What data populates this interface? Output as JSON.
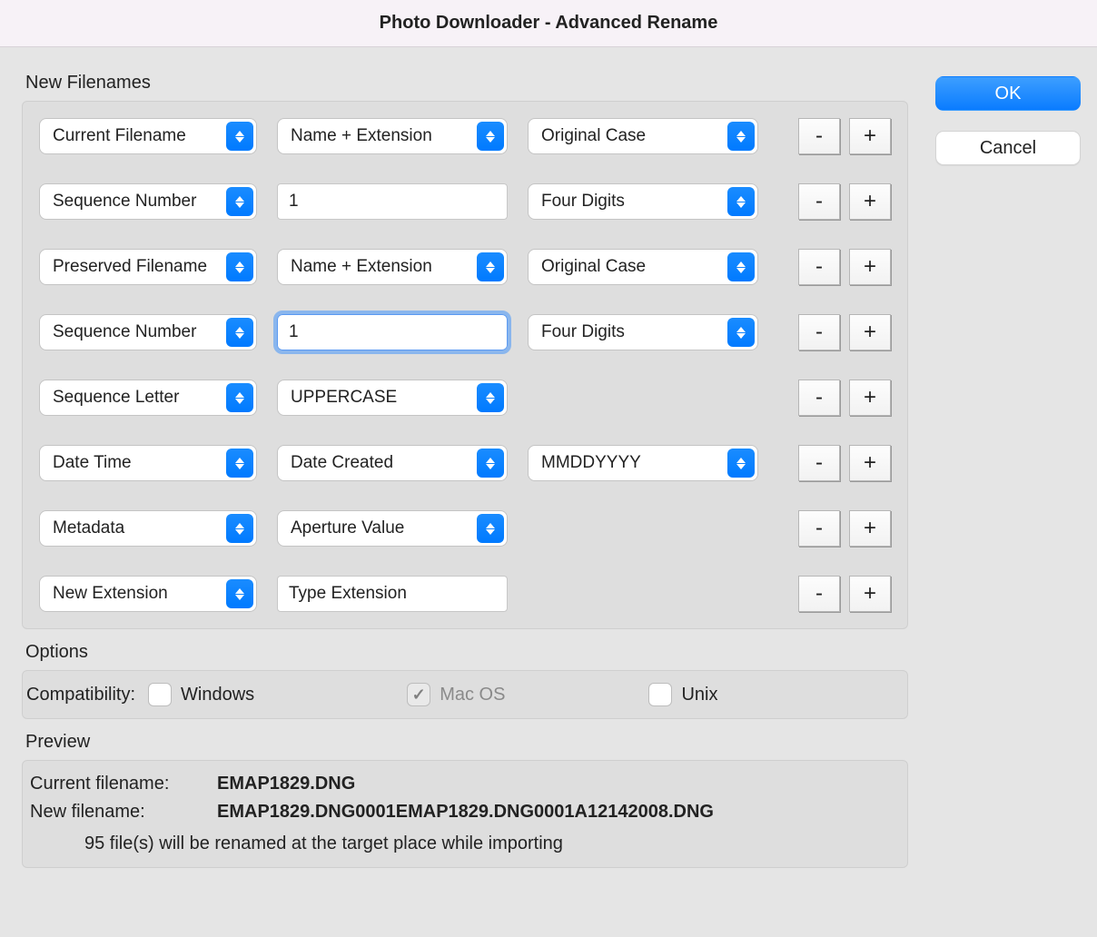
{
  "window": {
    "title": "Photo Downloader - Advanced Rename"
  },
  "sections": {
    "new_filenames": "New Filenames",
    "options": "Options",
    "preview": "Preview"
  },
  "rows": [
    {
      "c1": "Current Filename",
      "c2": "Name + Extension",
      "c2_type": "select",
      "c3": "Original Case"
    },
    {
      "c1": "Sequence Number",
      "c2": "1",
      "c2_type": "text",
      "c3": "Four Digits"
    },
    {
      "c1": "Preserved Filename",
      "c2": "Name + Extension",
      "c2_type": "select",
      "c3": "Original Case"
    },
    {
      "c1": "Sequence Number",
      "c2": "1",
      "c2_type": "text-focused",
      "c3": "Four Digits"
    },
    {
      "c1": "Sequence Letter",
      "c2": "UPPERCASE",
      "c2_type": "select",
      "c3": null
    },
    {
      "c1": "Date Time",
      "c2": "Date Created",
      "c2_type": "select",
      "c3": "MMDDYYYY"
    },
    {
      "c1": "Metadata",
      "c2": "Aperture Value",
      "c2_type": "select",
      "c3": null
    },
    {
      "c1": "New Extension",
      "c2": "Type Extension",
      "c2_type": "plain",
      "c3": null
    }
  ],
  "pm": {
    "minus": "-",
    "plus": "+"
  },
  "options": {
    "compatibility_label": "Compatibility:",
    "windows": "Windows",
    "macos": "Mac OS",
    "unix": "Unix"
  },
  "preview": {
    "current_label": "Current filename:",
    "current_value": "EMAP1829.DNG",
    "new_label": "New filename:",
    "new_value": "EMAP1829.DNG0001EMAP1829.DNG0001A12142008.DNG",
    "note": "95 file(s) will be renamed at the target place while importing"
  },
  "buttons": {
    "ok": "OK",
    "cancel": "Cancel"
  }
}
